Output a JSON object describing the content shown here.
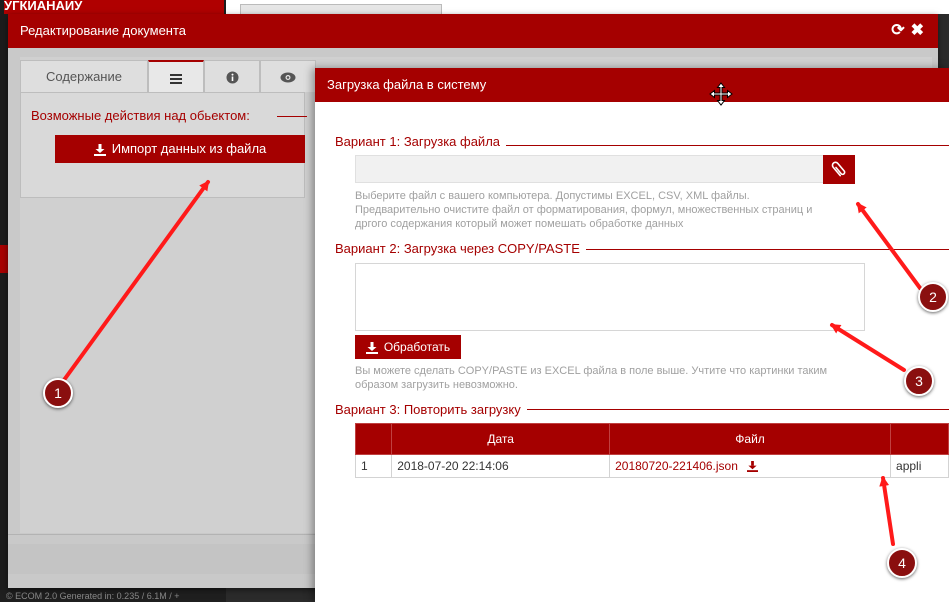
{
  "background": {
    "logo_text": "УГКИАНАИУ",
    "footer_text": "© ECOM 2.0 Generated in: 0.235 / 6.1M / +"
  },
  "main_dialog": {
    "title": "Редактирование документа",
    "tabs": [
      {
        "label": "Содержание",
        "icon": ""
      },
      {
        "label": "",
        "icon": "list-icon"
      },
      {
        "label": "",
        "icon": "info-icon"
      },
      {
        "label": "",
        "icon": "eye-icon"
      }
    ],
    "actions_title": "Возможные действия над обьектом:",
    "import_button_label": "Импорт данных из файла"
  },
  "upload_dialog": {
    "title": "Загрузка файла в систему",
    "variant1": {
      "title": "Вариант 1: Загрузка файла",
      "file_placeholder": "",
      "help": [
        "Выберите файл с вашего компьютера. Допустимы EXCEL, CSV, XML файлы.",
        "Предварительно очистите файл от форматирования, формул, множественных страниц и",
        "дргого содержания который может помешать обработке данных"
      ]
    },
    "variant2": {
      "title": "Вариант 2: Загрузка через COPY/PASTE",
      "textarea_value": "",
      "process_button_label": "Обработать",
      "help": [
        "Вы можете сделать COPY/PASTE из EXCEL файла в поле выше. Учтите что картинки таким",
        "образом загрузить невозможно."
      ]
    },
    "variant3": {
      "title": "Вариант 3: Повторить загрузку",
      "columns": [
        "",
        "Дата",
        "Файл",
        ""
      ],
      "rows": [
        {
          "num": "1",
          "date": "2018-07-20 22:14:06",
          "file": "20180720-221406.json",
          "type": "appli"
        }
      ]
    }
  },
  "annotations": [
    "1",
    "2",
    "3",
    "4"
  ],
  "colors": {
    "accent": "#a50000",
    "arrow": "#ff1a1a",
    "badge": "#8a0f0f"
  }
}
